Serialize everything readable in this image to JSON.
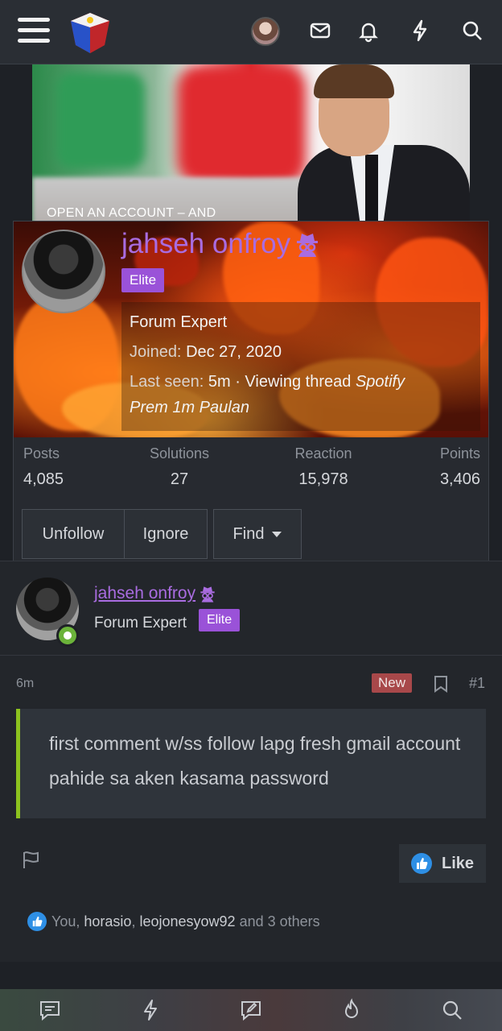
{
  "banner": {
    "text": "OPEN AN ACCOUNT – AND"
  },
  "popup": {
    "username": "jahseh onfroy",
    "badge": "Elite",
    "title": "Forum Expert",
    "joined_label": "Joined:",
    "joined_value": "Dec 27, 2020",
    "last_seen_label": "Last seen:",
    "last_seen_value": "5m",
    "activity_prefix": "· Viewing thread",
    "activity_thread_line1": "Spotify",
    "activity_thread_line2": "Prem 1m Paulan",
    "stats": [
      {
        "label": "Posts",
        "value": "4,085"
      },
      {
        "label": "Solutions",
        "value": "27"
      },
      {
        "label": "Reaction",
        "value": "15,978"
      },
      {
        "label": "Points",
        "value": "3,406"
      }
    ],
    "buttons": {
      "unfollow": "Unfollow",
      "ignore": "Ignore",
      "find": "Find"
    }
  },
  "post": {
    "username": "jahseh onfroy",
    "user_title": "Forum Expert",
    "badge": "Elite",
    "time": "6m",
    "new_badge": "New",
    "number": "#1",
    "content": "first comment w/ss follow lapg fresh gmail account pahide sa aken kasama password",
    "like_label": "Like",
    "reactions": {
      "you": "You",
      "user1": "horasio",
      "user2": "leojonesyow92",
      "rest": "and 3 others"
    }
  },
  "colors": {
    "accent_purple": "#a96ce0",
    "elite_badge": "#9a52d8",
    "new_badge": "#a8484a",
    "quote_border": "#8dc21f",
    "like_blue": "#2e8fe5",
    "online_green": "#6bb33a"
  }
}
